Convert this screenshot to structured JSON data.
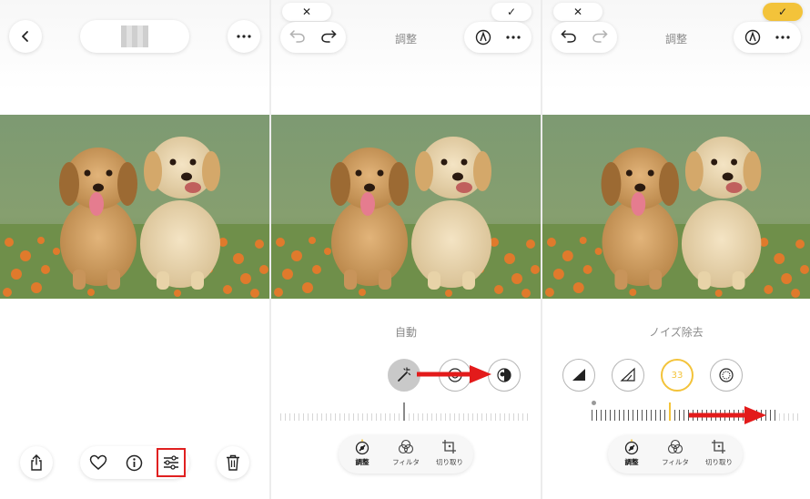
{
  "panel1": {
    "bottom_bar": {
      "share_icon": "share-icon",
      "favorite_icon": "heart-icon",
      "info_icon": "info-icon",
      "adjust_icon": "sliders-icon",
      "delete_icon": "trash-icon",
      "highlight_color": "#e02020"
    }
  },
  "panel2": {
    "cancel_label": "✕",
    "done_label": "✓",
    "header_title": "調整",
    "adjust_mode_label": "自動",
    "tabs": [
      {
        "label": "調整"
      },
      {
        "label": "フィルタ"
      },
      {
        "label": "切り取り"
      }
    ]
  },
  "panel3": {
    "cancel_label": "✕",
    "done_label": "✓",
    "header_title": "調整",
    "adjust_mode_label": "ノイズ除去",
    "noise_value": "33",
    "tabs": [
      {
        "label": "調整"
      },
      {
        "label": "フィルタ"
      },
      {
        "label": "切り取り"
      }
    ]
  },
  "colors": {
    "accent_yellow": "#f3c33a",
    "arrow_red": "#e31b1b"
  }
}
